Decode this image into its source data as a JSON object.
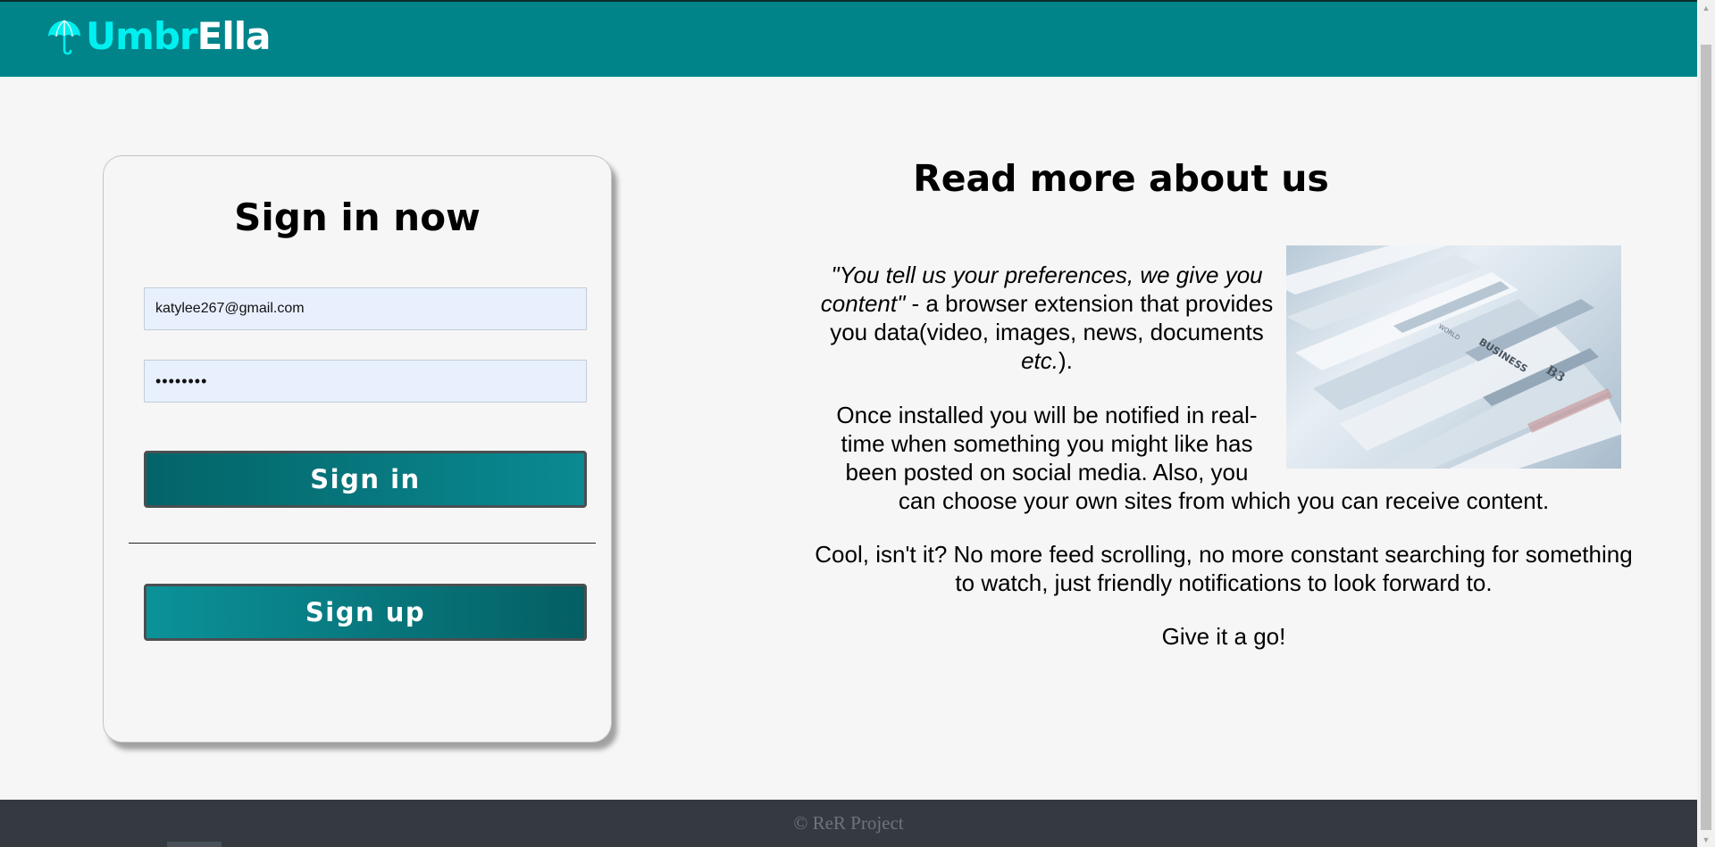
{
  "header": {
    "logo_text_part1": "Umbr",
    "logo_text_part2": "Ella",
    "logo_icon": "umbrella-icon"
  },
  "signin": {
    "title": "Sign in now",
    "email_value": "katylee267@gmail.com",
    "password_value": "••••••••",
    "signin_label": "Sign in",
    "signup_label": "Sign up"
  },
  "about": {
    "title": "Read more about us",
    "p1_quote": "\"You tell us your preferences, we give you content\"",
    "p1_rest": " - a browser extension that provides you data(video, images, news, documents ",
    "p1_etc": "etc.",
    "p1_end": ").",
    "p2a": "Once installed you will be notified in real-time when something you might like has been posted on social media. Also, you",
    "p2b": "can choose your own sites from which you can receive content.",
    "p3": "Cool, isn't it? No more feed scrolling, no more constant searching for something to watch, just friendly notifications to look forward to.",
    "p4": "Give it a go!",
    "image_alt": "newspapers"
  },
  "footer": {
    "text": "© ReR Project"
  },
  "colors": {
    "header_bg": "#00848a",
    "logo_accent": "#00f0f0",
    "footer_bg": "#343a40",
    "button_dark": "#036468",
    "button_light": "#0a8a92"
  }
}
